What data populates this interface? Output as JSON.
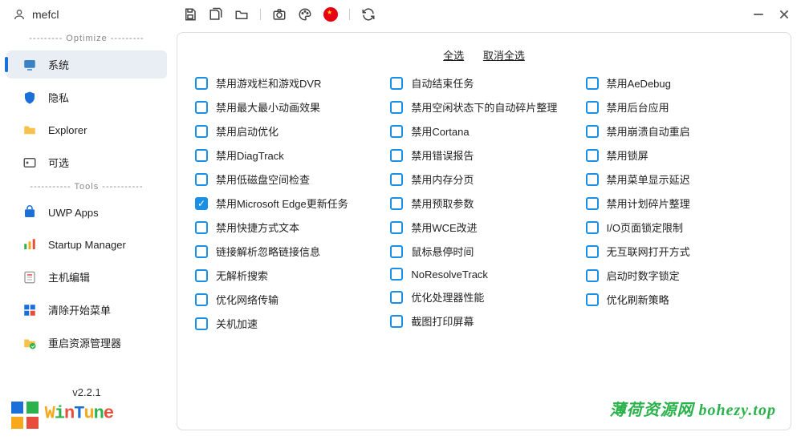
{
  "user": {
    "name": "mefcl"
  },
  "sidebar": {
    "section_optimize": "--------- Optimize ---------",
    "section_tools": "----------- Tools -----------",
    "items": [
      {
        "label": "系统",
        "icon": "system"
      },
      {
        "label": "隐私",
        "icon": "shield"
      },
      {
        "label": "Explorer",
        "icon": "folder"
      },
      {
        "label": "可选",
        "icon": "optional"
      },
      {
        "label": "UWP Apps",
        "icon": "store"
      },
      {
        "label": "Startup Manager",
        "icon": "startup"
      },
      {
        "label": "主机编辑",
        "icon": "host"
      },
      {
        "label": "清除开始菜单",
        "icon": "clear"
      },
      {
        "label": "重启资源管理器",
        "icon": "restart"
      }
    ]
  },
  "version": "v2.2.1",
  "logo_text": "WinTune",
  "top_links": {
    "select_all": "全选",
    "deselect_all": "取消全选"
  },
  "options": {
    "col1": [
      {
        "label": "禁用游戏栏和游戏DVR",
        "checked": false
      },
      {
        "label": "禁用最大最小动画效果",
        "checked": false
      },
      {
        "label": "禁用启动优化",
        "checked": false
      },
      {
        "label": "禁用DiagTrack",
        "checked": false
      },
      {
        "label": "禁用低磁盘空间检查",
        "checked": false
      },
      {
        "label": "禁用Microsoft Edge更新任务",
        "checked": true
      },
      {
        "label": "禁用快捷方式文本",
        "checked": false
      },
      {
        "label": "链接解析忽略链接信息",
        "checked": false
      },
      {
        "label": "无解析搜索",
        "checked": false
      },
      {
        "label": "优化网络传输",
        "checked": false
      },
      {
        "label": "关机加速",
        "checked": false
      }
    ],
    "col2": [
      {
        "label": "自动结束任务",
        "checked": false
      },
      {
        "label": "禁用空闲状态下的自动碎片整理",
        "checked": false
      },
      {
        "label": "禁用Cortana",
        "checked": false
      },
      {
        "label": "禁用错误报告",
        "checked": false
      },
      {
        "label": "禁用内存分页",
        "checked": false
      },
      {
        "label": "禁用预取参数",
        "checked": false
      },
      {
        "label": "禁用WCE改进",
        "checked": false
      },
      {
        "label": "鼠标悬停时间",
        "checked": false
      },
      {
        "label": "NoResolveTrack",
        "checked": false
      },
      {
        "label": "优化处理器性能",
        "checked": false
      },
      {
        "label": "截图打印屏幕",
        "checked": false
      }
    ],
    "col3": [
      {
        "label": "禁用AeDebug",
        "checked": false
      },
      {
        "label": "禁用后台应用",
        "checked": false
      },
      {
        "label": "禁用崩溃自动重启",
        "checked": false
      },
      {
        "label": "禁用锁屏",
        "checked": false
      },
      {
        "label": "禁用菜单显示延迟",
        "checked": false
      },
      {
        "label": "禁用计划碎片整理",
        "checked": false
      },
      {
        "label": "I/O页面锁定限制",
        "checked": false
      },
      {
        "label": "无互联网打开方式",
        "checked": false
      },
      {
        "label": "启动时数字锁定",
        "checked": false
      },
      {
        "label": "优化刷新策略",
        "checked": false
      }
    ]
  },
  "watermark": "薄荷资源网  bohezy.top"
}
